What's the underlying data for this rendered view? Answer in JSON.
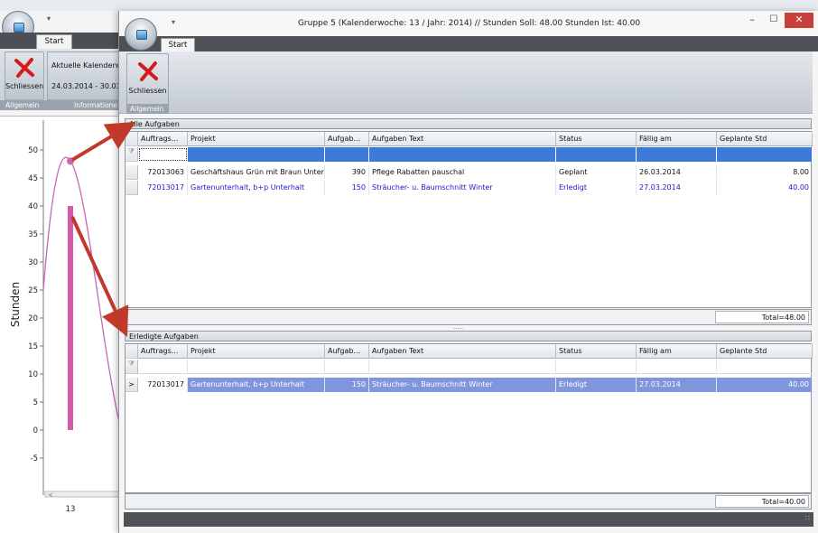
{
  "background_window": {
    "qat_glyph": "▾",
    "tab_start": "Start",
    "close_label": "Schliessen",
    "info_line1": "Aktuelle Kalenderwo",
    "info_line2": "24.03.2014 - 30.03",
    "group_allgemein": "Allgemein",
    "group_informationen": "Informatione",
    "chart": {
      "y_title": "Stunden",
      "y_ticks": [
        "50",
        "45",
        "40",
        "35",
        "30",
        "25",
        "20",
        "15",
        "10",
        "5",
        "0",
        "-5"
      ],
      "x_ticks": [
        "13"
      ]
    }
  },
  "chart_data": {
    "type": "bar",
    "categories": [
      "13"
    ],
    "series": [
      {
        "values": [
          40
        ],
        "color": "#d35aa8"
      },
      {
        "values": [
          48
        ],
        "color": "#c867b0",
        "style": "line"
      }
    ],
    "title": "",
    "xlabel": "",
    "ylabel": "Stunden",
    "ylim": [
      -5,
      53
    ]
  },
  "window": {
    "qat_glyph": "▾",
    "title": "Gruppe 5 (Kalenderwoche: 13 / Jahr: 2014) // Stunden Soll: 48.00 Stunden Ist: 40.00",
    "minimize": "–",
    "maximize": "☐",
    "close": "✕",
    "tab_start": "Start",
    "close_label": "Schliessen",
    "group_allgemein": "Allgemein",
    "grip": "∷"
  },
  "columns": [
    "Auftrags...",
    "Projekt",
    "Aufgab...",
    "Aufgaben Text",
    "Status",
    "Fällig am",
    "Geplante Std"
  ],
  "filter_icon": "⧩",
  "row_indicator": ">",
  "all_tasks": {
    "title": "Alle Aufgaben",
    "rows": [
      {
        "auftrag": "72013063",
        "projekt": "Geschäftshaus Grün mit Braun Unter...",
        "aufgabe": "390",
        "text": "Pflege Rabatten pauschal",
        "status": "Geplant",
        "faellig": "26.03.2014",
        "std": "8.00"
      },
      {
        "auftrag": "72013017",
        "projekt": "Gartenunterhalt, b+p Unterhalt",
        "aufgabe": "150",
        "text": "Sträucher- u. Baumschnitt Winter",
        "status": "Erledigt",
        "faellig": "27.03.2014",
        "std": "40.00"
      }
    ],
    "total": "Total=48.00"
  },
  "done_tasks": {
    "title": "Erledigte Aufgaben",
    "rows": [
      {
        "auftrag": "72013017",
        "projekt": "Gartenunterhalt, b+p Unterhalt",
        "aufgabe": "150",
        "text": "Sträucher- u. Baumschnitt Winter",
        "status": "Erledigt",
        "faellig": "27.03.2014",
        "std": "40.00"
      }
    ],
    "total": "Total=40.00"
  },
  "splitter": ".....",
  "colors": {
    "selection_blue": "#3b7ad8",
    "row_blue_text": "#1a1ac8",
    "selected_row": "#7f95dc",
    "arrow_red": "#c0392b",
    "close_red": "#c7413a"
  }
}
